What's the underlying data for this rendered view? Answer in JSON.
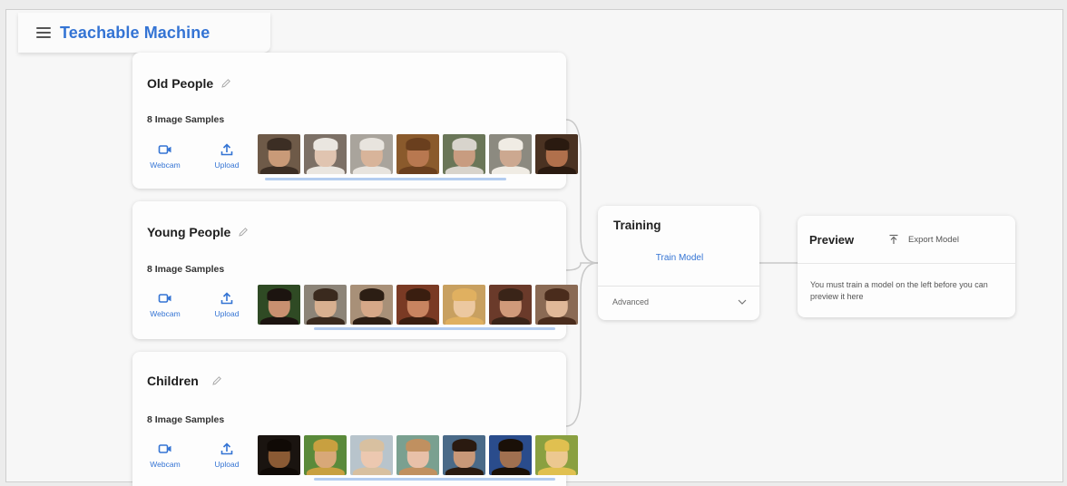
{
  "app": {
    "title": "Teachable Machine"
  },
  "classes": [
    {
      "name": "Old People",
      "samples_label": "8 Image Samples",
      "webcam_label": "Webcam",
      "upload_label": "Upload",
      "thumbs": [
        {
          "bg": "#6e5a48",
          "skin": "#c99a78",
          "hair": "#3c2e24"
        },
        {
          "bg": "#7c7066",
          "skin": "#e0c4b0",
          "hair": "#eae6e0"
        },
        {
          "bg": "#a9a49c",
          "skin": "#d8b49a",
          "hair": "#e8e4de"
        },
        {
          "bg": "#8a5a2c",
          "skin": "#b87850",
          "hair": "#6a3f1e"
        },
        {
          "bg": "#6a7658",
          "skin": "#c89c80",
          "hair": "#d8d4cc"
        },
        {
          "bg": "#8c8a80",
          "skin": "#cca890",
          "hair": "#f0ece4"
        },
        {
          "bg": "#4a3222",
          "skin": "#b0704c",
          "hair": "#2a1a10"
        }
      ]
    },
    {
      "name": "Young People",
      "samples_label": "8 Image Samples",
      "webcam_label": "Webcam",
      "upload_label": "Upload",
      "thumbs": [
        {
          "bg": "#2f4a24",
          "skin": "#c89070",
          "hair": "#1c1410"
        },
        {
          "bg": "#8c8478",
          "skin": "#d8b090",
          "hair": "#3a2a1e"
        },
        {
          "bg": "#a89078",
          "skin": "#d6a888",
          "hair": "#2c1e14"
        },
        {
          "bg": "#7a3a24",
          "skin": "#c88460",
          "hair": "#3a1e10"
        },
        {
          "bg": "#c8a060",
          "skin": "#ecc8a0",
          "hair": "#e0b060"
        },
        {
          "bg": "#6a3a2a",
          "skin": "#d09a7a",
          "hair": "#3a2418"
        },
        {
          "bg": "#8a6a54",
          "skin": "#e0b898",
          "hair": "#4a2c1c"
        }
      ]
    },
    {
      "name": "Children",
      "samples_label": "8 Image Samples",
      "webcam_label": "Webcam",
      "upload_label": "Upload",
      "thumbs": [
        {
          "bg": "#1a1410",
          "skin": "#8a5a34",
          "hair": "#100a06"
        },
        {
          "bg": "#5a8a3a",
          "skin": "#d8a878",
          "hair": "#c8a040"
        },
        {
          "bg": "#b8c4cc",
          "skin": "#ecc8b0",
          "hair": "#d8c0a0"
        },
        {
          "bg": "#7aa090",
          "skin": "#e8c0a8",
          "hair": "#c09060"
        },
        {
          "bg": "#4a6a88",
          "skin": "#c89878",
          "hair": "#2a1a10"
        },
        {
          "bg": "#2a4c8c",
          "skin": "#a07050",
          "hair": "#1a1008"
        },
        {
          "bg": "#8aa040",
          "skin": "#ecc890",
          "hair": "#e0c050"
        }
      ]
    }
  ],
  "training": {
    "title": "Training",
    "train_button": "Train Model",
    "advanced_label": "Advanced"
  },
  "preview": {
    "title": "Preview",
    "export_button": "Export Model",
    "message": "You must train a model on the left before you can preview it here"
  },
  "colors": {
    "accent": "#3474d4",
    "card_bg": "#fdfdfd",
    "page_bg": "#f7f7f7"
  },
  "icons": {
    "menu": "hamburger-icon",
    "pencil": "pencil-icon",
    "webcam": "webcam-icon",
    "upload": "upload-icon",
    "export": "export-icon",
    "advanced": "chevron-down-icon"
  }
}
